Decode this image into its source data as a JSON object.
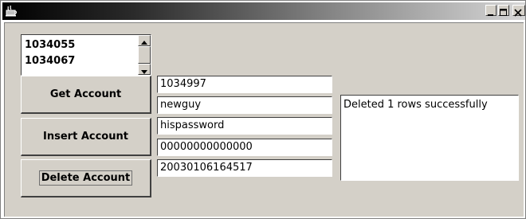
{
  "window": {
    "title": "",
    "icons": {
      "app": "java-app-icon",
      "minimize": "minimize-icon",
      "maximize": "maximize-icon",
      "close": "close-icon"
    }
  },
  "account_list": {
    "items": [
      "1034055",
      "1034067"
    ]
  },
  "buttons": {
    "get_account": "Get Account",
    "insert_account": "Insert Account",
    "delete_account": "Delete Account"
  },
  "fields": {
    "account_id": "1034997",
    "username": "newguy",
    "password": "hispassword",
    "number": "00000000000000",
    "timestamp": "20030106164517"
  },
  "status": {
    "message": "Deleted 1 rows successfully"
  }
}
